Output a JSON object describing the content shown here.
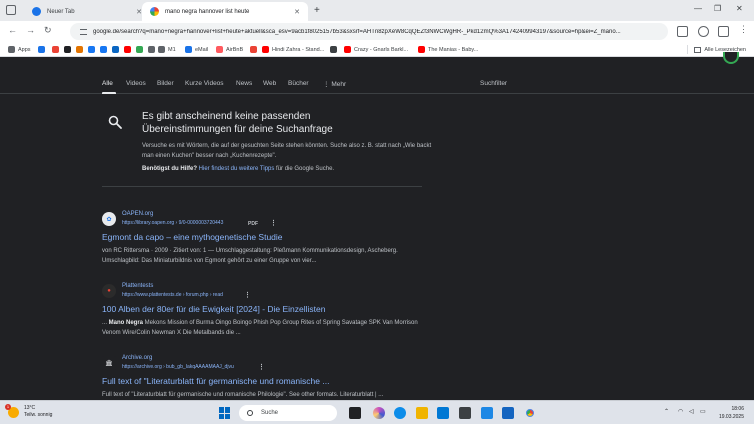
{
  "browser": {
    "tabs": [
      {
        "title": "Neuer Tab",
        "active": false
      },
      {
        "title": "mano negra hannover list heute",
        "active": true
      }
    ],
    "url": "google.de/search?q=mano+negra+hannover+list+heute+aktuell&sca_esv=9acb1f8025157b53&sxsrf=AHTn8zpXeW8CqQEZf3NWCWgHR-_Pkd12mQ%3A1742409943197&source=hp&ei=Z_mano...",
    "bookmarks": [
      {
        "label": "Apps",
        "color": "#5f6368"
      },
      {
        "label": "",
        "color": "#1a73e8"
      },
      {
        "label": "",
        "color": "#ea4335"
      },
      {
        "label": "",
        "color": "#202124"
      },
      {
        "label": "",
        "color": "#e37400"
      },
      {
        "label": "",
        "color": "#1877f2"
      },
      {
        "label": "",
        "color": "#1877f2"
      },
      {
        "label": "",
        "color": "#0a66c2"
      },
      {
        "label": "",
        "color": "#ff0000"
      },
      {
        "label": "",
        "color": "#34a853"
      },
      {
        "label": "",
        "color": "#5f6368"
      },
      {
        "label": "M1",
        "color": "#5f6368"
      },
      {
        "label": "eMail",
        "color": "#1a73e8"
      },
      {
        "label": "AirBnB",
        "color": "#ff5a5f"
      },
      {
        "label": "",
        "color": "#ea4335"
      },
      {
        "label": "Hindi Zahra - Stand...",
        "color": "#ff0000"
      },
      {
        "label": "",
        "color": "#3c4043"
      },
      {
        "label": "Crazy - Gnarls Barkl...",
        "color": "#ff0000"
      },
      {
        "label": "The Manias - Baby...",
        "color": "#ff0000"
      }
    ],
    "reading_list": "Alle Lesezeichen"
  },
  "search_tabs": [
    "Alle",
    "Videos",
    "Bilder",
    "Kurze Videos",
    "News",
    "Web",
    "Bücher",
    "Mehr"
  ],
  "more_icon": "⋮",
  "filter_label": "Suchfilter",
  "no_match": {
    "title": "Es gibt anscheinend keine passenden Übereinstimmungen für deine Suchanfrage",
    "body": "Versuche es mit Wörtern, die auf der gesuchten Seite stehen könnten. Suche also z. B. statt nach „Wie backt man einen Kuchen\" besser nach „Kuchenrezepte\".",
    "help_bold": "Benötigst du Hilfe?",
    "help_link": "Hier findest du weitere Tipps",
    "help_tail": "für die Google Suche."
  },
  "results": [
    {
      "site": "OAPEN.org",
      "url": "https://library.oapen.org › 9/0-0000003720443",
      "badge": "PDF",
      "title": "Egmont da capo – eine mythogenetische Studie",
      "snippet_pre": "",
      "snippet_bold": "",
      "snippet": "von RC Rittersma · 2009 · Zitiert von: 1 — Umschlaggestaltung: Pleßmann Kommunikationsdesign, Ascheberg. Umschlagbild: Das Miniaturbildnis von Egmont gehört zu einer Gruppe von vier..."
    },
    {
      "site": "Plattentests",
      "url": "https://www.plattentests.de › forum.php › read",
      "badge": "",
      "title": "100 Alben der 80er für die Ewigkeit [2024] - Die Einzellisten",
      "snippet_pre": "... ",
      "snippet_bold": "Mano Negra",
      "snippet": " Mekons Mission of Burma Oingo Boingo Phish Pop Group Rites of Spring Savatage SPK Van Morrison Venom Wire/Colin Newman X Die Metalbands die ..."
    },
    {
      "site": "Archive.org",
      "url": "https://archive.org › bub_gb_IakqAAAAMAAJ_djvu",
      "badge": "",
      "title": "Full text of \"Literaturblatt für germanische und romanische ...",
      "snippet_pre": "",
      "snippet_bold": "",
      "snippet": "Full text of \"Literaturblatt für germanische und romanische Philologie\". See other formats. Literaturblatt | ..."
    }
  ],
  "taskbar": {
    "temperature": "13°C",
    "weather": "Teilw. sonnig",
    "weather_badge": "1",
    "search_label": "Suche",
    "time": "18:06",
    "date": "19.03.2025"
  }
}
